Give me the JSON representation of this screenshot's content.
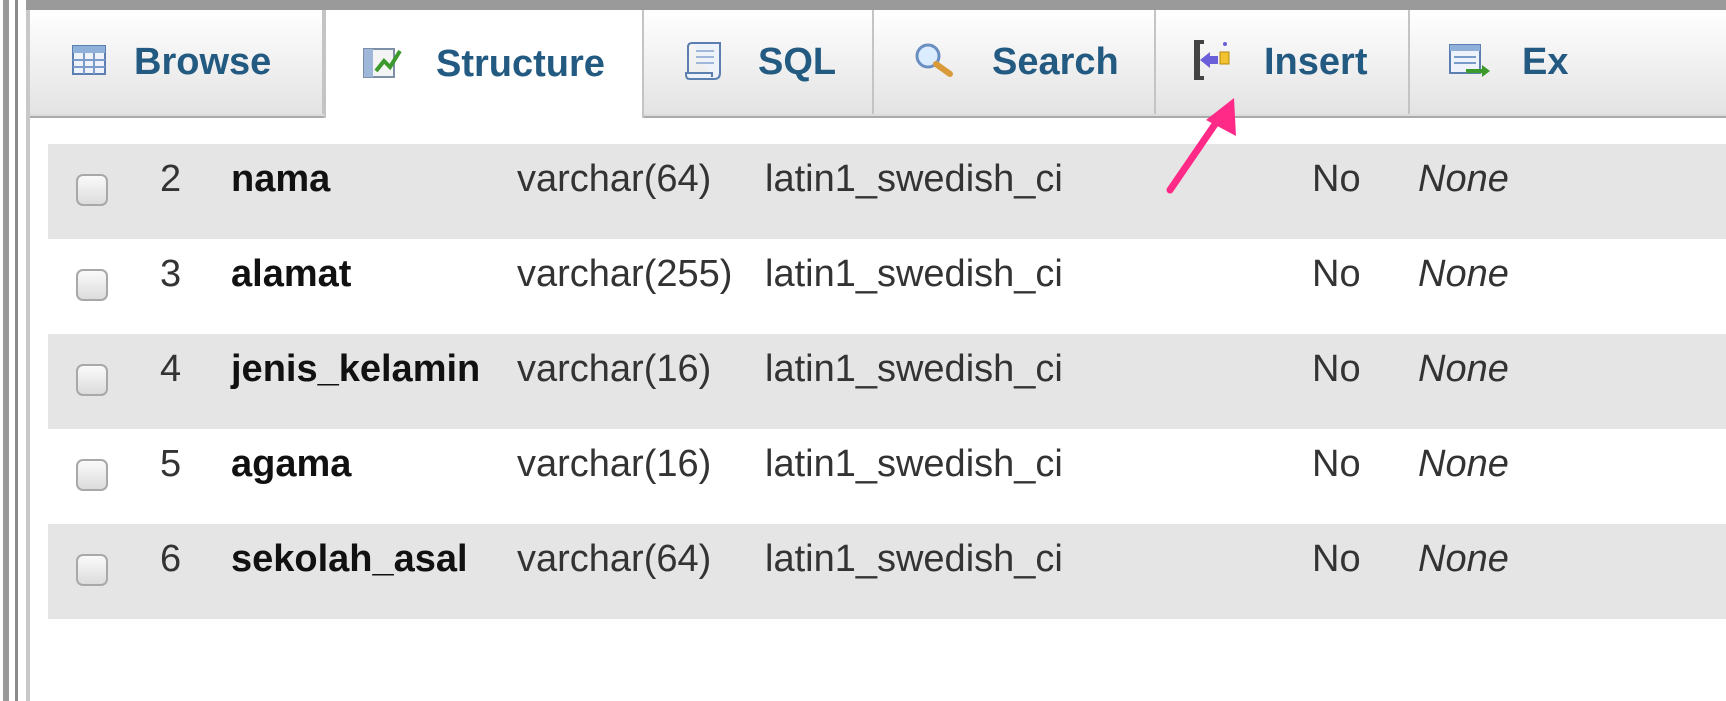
{
  "tabs": [
    {
      "label": "Browse",
      "icon": "table-grid-icon"
    },
    {
      "label": "Structure",
      "icon": "structure-icon",
      "active": true
    },
    {
      "label": "SQL",
      "icon": "sql-scroll-icon"
    },
    {
      "label": "Search",
      "icon": "magnifier-icon"
    },
    {
      "label": "Insert",
      "icon": "insert-icon"
    },
    {
      "label": "Ex",
      "icon": "export-icon"
    }
  ],
  "rows": [
    {
      "num": "2",
      "name": "nama",
      "type": "varchar(64)",
      "collation": "latin1_swedish_ci",
      "null": "No",
      "default": "None"
    },
    {
      "num": "3",
      "name": "alamat",
      "type": "varchar(255)",
      "collation": "latin1_swedish_ci",
      "null": "No",
      "default": "None"
    },
    {
      "num": "4",
      "name": "jenis_kelamin",
      "type": "varchar(16)",
      "collation": "latin1_swedish_ci",
      "null": "No",
      "default": "None"
    },
    {
      "num": "5",
      "name": "agama",
      "type": "varchar(16)",
      "collation": "latin1_swedish_ci",
      "null": "No",
      "default": "None"
    },
    {
      "num": "6",
      "name": "sekolah_asal",
      "type": "varchar(64)",
      "collation": "latin1_swedish_ci",
      "null": "No",
      "default": "None"
    }
  ],
  "colors": {
    "tab_text": "#235a81",
    "row_odd": "#e5e5e5",
    "row_even": "#ffffff",
    "annotation_arrow": "#ff2a88"
  }
}
